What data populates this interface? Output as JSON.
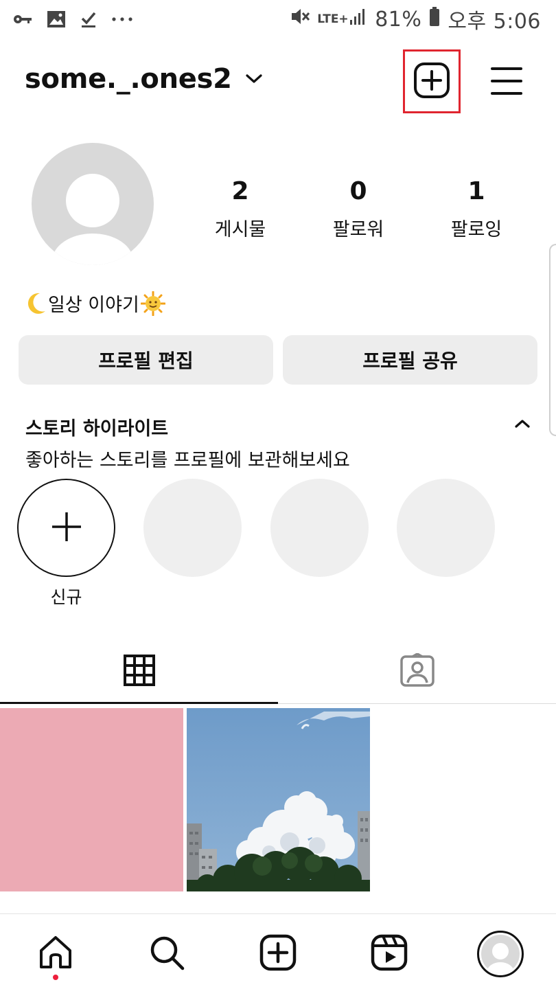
{
  "status_bar": {
    "left_icons": [
      "key-icon",
      "image-icon",
      "download-done-icon",
      "more-dots-icon"
    ],
    "network": "LTE+",
    "battery": "81%",
    "time": "오후 5:06"
  },
  "header": {
    "username": "some._.ones2",
    "create_icon": "plus-square-icon",
    "menu_icon": "hamburger-menu-icon"
  },
  "profile": {
    "stats": [
      {
        "value": "2",
        "label": "게시물"
      },
      {
        "value": "0",
        "label": "팔로워"
      },
      {
        "value": "1",
        "label": "팔로잉"
      }
    ],
    "bio": "일상 이야기",
    "edit_button": "프로필 편집",
    "share_button": "프로필 공유"
  },
  "highlights": {
    "title": "스토리 하이라이트",
    "subtitle": "좋아하는 스토리를 프로필에 보관해보세요",
    "new_label": "신규"
  },
  "tabs": [
    {
      "icon": "grid-icon",
      "active": true
    },
    {
      "icon": "tagged-person-icon",
      "active": false
    }
  ],
  "posts": [
    {
      "kind": "pink-solid",
      "color": "#ecaab4"
    },
    {
      "kind": "sky-clouds-photo"
    }
  ],
  "bottom_nav": [
    {
      "icon": "home-icon",
      "active": true
    },
    {
      "icon": "search-icon"
    },
    {
      "icon": "create-icon"
    },
    {
      "icon": "reels-icon"
    },
    {
      "icon": "profile-avatar-icon"
    }
  ],
  "colors": {
    "highlight_box": "#e0252f",
    "button_bg": "#ededed",
    "notification_dot": "#ed1f3c"
  }
}
